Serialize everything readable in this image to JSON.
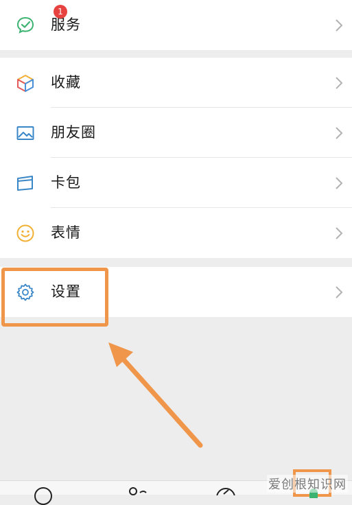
{
  "menu": {
    "services": {
      "label": "服务",
      "icon": "wechat-service-icon"
    },
    "favorites": {
      "label": "收藏",
      "icon": "cube-icon"
    },
    "moments": {
      "label": "朋友圈",
      "icon": "picture-icon"
    },
    "cards": {
      "label": "卡包",
      "icon": "wallet-icon"
    },
    "stickers": {
      "label": "表情",
      "icon": "smiley-icon"
    },
    "settings": {
      "label": "设置",
      "icon": "gear-icon"
    }
  },
  "tabbar": {
    "chats_badge": "1"
  },
  "watermark": "爱创根知识网",
  "colors": {
    "accent_highlight": "#f0964a",
    "wechat_green": "#3cb371",
    "badge_red": "#e64340",
    "background": "#ededed"
  }
}
